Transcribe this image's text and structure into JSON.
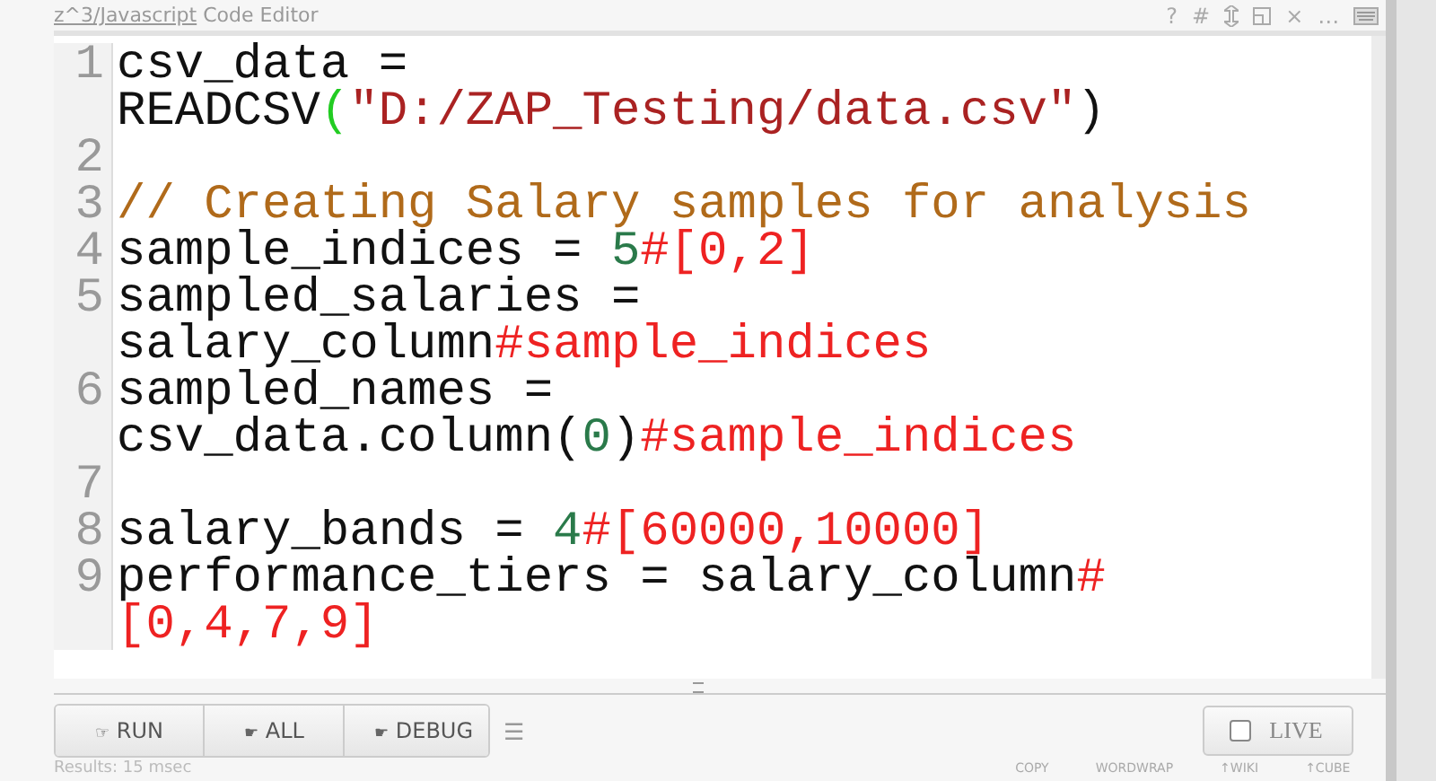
{
  "window": {
    "title_link": "z^3/Javascript",
    "title": "Code Editor",
    "tools": [
      {
        "kind": "help",
        "label": "?"
      },
      {
        "kind": "hash",
        "label": "#"
      },
      {
        "kind": "resize"
      },
      {
        "kind": "popout"
      },
      {
        "kind": "close",
        "label": "×"
      },
      {
        "kind": "more",
        "label": "…"
      },
      {
        "kind": "keyboard"
      }
    ]
  },
  "code_lines": [
    {
      "number": "1",
      "rows": [
        [
          {
            "kind": "plain",
            "text": "csv_data ="
          }
        ],
        [
          {
            "kind": "plain",
            "text": "READCSV"
          },
          {
            "kind": "bracket",
            "text": "("
          },
          {
            "kind": "string",
            "text": "\"D:/ZAP_Testing/data.csv\""
          },
          {
            "kind": "plain",
            "text": ")"
          }
        ]
      ]
    },
    {
      "number": "2",
      "rows": [
        []
      ]
    },
    {
      "number": "3",
      "rows": [
        [
          {
            "kind": "comment",
            "text": "// Creating Salary samples for analysis"
          }
        ]
      ]
    },
    {
      "number": "4",
      "rows": [
        [
          {
            "kind": "plain",
            "text": "sample_indices = "
          },
          {
            "kind": "number",
            "text": "5"
          },
          {
            "kind": "operator",
            "text": "#[0,2]"
          }
        ]
      ]
    },
    {
      "number": "5",
      "rows": [
        [
          {
            "kind": "plain",
            "text": "sampled_salaries ="
          }
        ],
        [
          {
            "kind": "plain",
            "text": "salary_column"
          },
          {
            "kind": "operator",
            "text": "#sample_indices"
          }
        ]
      ]
    },
    {
      "number": "6",
      "rows": [
        [
          {
            "kind": "plain",
            "text": "sampled_names ="
          }
        ],
        [
          {
            "kind": "plain",
            "text": "csv_data.column("
          },
          {
            "kind": "number",
            "text": "0"
          },
          {
            "kind": "plain",
            "text": ")"
          },
          {
            "kind": "operator",
            "text": "#sample_indices"
          }
        ]
      ]
    },
    {
      "number": "7",
      "rows": [
        []
      ]
    },
    {
      "number": "8",
      "rows": [
        [
          {
            "kind": "plain",
            "text": "salary_bands = "
          },
          {
            "kind": "number",
            "text": "4"
          },
          {
            "kind": "operator",
            "text": "#[60000,10000]"
          }
        ]
      ]
    },
    {
      "number": "9",
      "rows": [
        [
          {
            "kind": "plain",
            "text": "performance_tiers = salary_column"
          },
          {
            "kind": "operator",
            "text": "#"
          }
        ],
        [
          {
            "kind": "operator",
            "text": "[0,4,7,9]"
          }
        ]
      ]
    }
  ],
  "toolbar": {
    "buttons": [
      {
        "icon": "☞",
        "label": "RUN"
      },
      {
        "icon": "☛",
        "label": "ALL"
      },
      {
        "icon": "☛",
        "label": "DEBUG"
      }
    ],
    "menu": "☰",
    "live": {
      "label": "LIVE",
      "checked": false
    }
  },
  "status": {
    "results": "Results: 15 msec",
    "links": [
      "COPY",
      "WORDWRAP",
      "↑WIKI",
      "↑CUBE"
    ]
  }
}
